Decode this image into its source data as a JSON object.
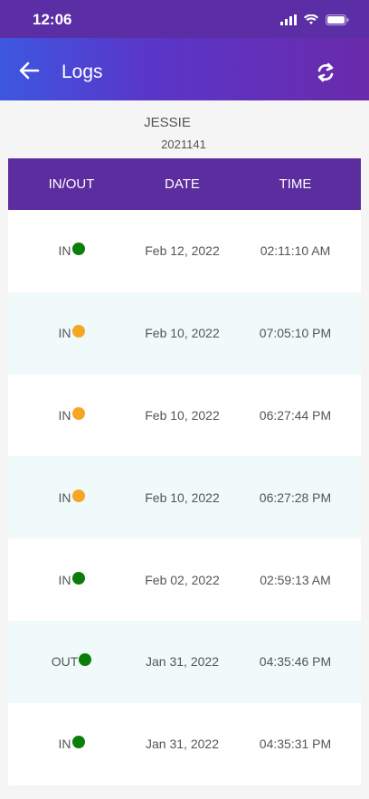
{
  "status_bar": {
    "time": "12:06"
  },
  "app_bar": {
    "title": "Logs"
  },
  "profile": {
    "name": "JESSIE",
    "id": "2021141"
  },
  "table": {
    "headers": [
      "IN/OUT",
      "DATE",
      "TIME"
    ],
    "rows": [
      {
        "type": "IN",
        "date": "Feb 12, 2022",
        "time": "02:11:10 AM",
        "status_color": "#0a7d0a"
      },
      {
        "type": "IN",
        "date": "Feb 10, 2022",
        "time": "07:05:10 PM",
        "status_color": "#f5a623"
      },
      {
        "type": "IN",
        "date": "Feb 10, 2022",
        "time": "06:27:44 PM",
        "status_color": "#f5a623"
      },
      {
        "type": "IN",
        "date": "Feb 10, 2022",
        "time": "06:27:28 PM",
        "status_color": "#f5a623"
      },
      {
        "type": "IN",
        "date": "Feb 02, 2022",
        "time": "02:59:13 AM",
        "status_color": "#0a7d0a"
      },
      {
        "type": "OUT",
        "date": "Jan 31, 2022",
        "time": "04:35:46 PM",
        "status_color": "#0a7d0a"
      },
      {
        "type": "IN",
        "date": "Jan 31, 2022",
        "time": "04:35:31 PM",
        "status_color": "#0a7d0a"
      }
    ]
  },
  "colors": {
    "header_bg": "#5c2d9e",
    "status_on_time": "#0a7d0a",
    "status_late": "#f5a623"
  }
}
